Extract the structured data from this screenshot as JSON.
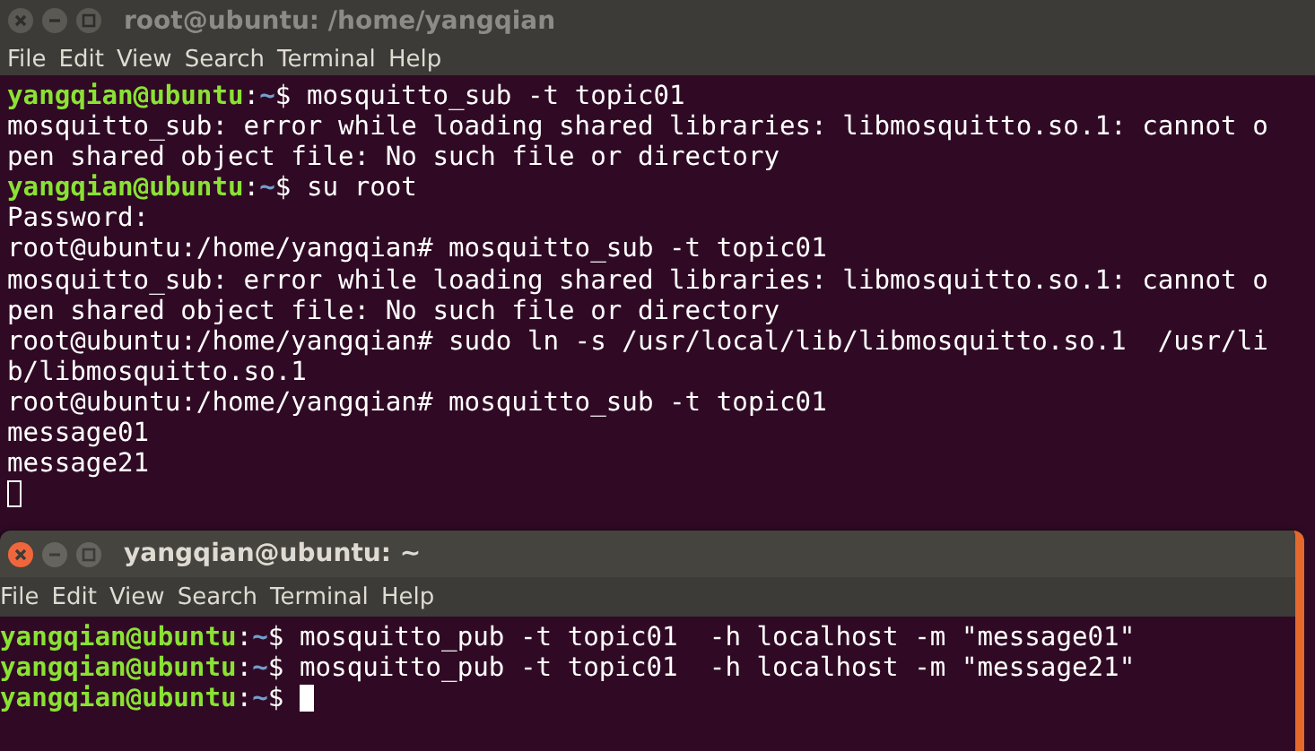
{
  "windows": [
    {
      "title": "root@ubuntu: /home/yangqian",
      "active": false,
      "menu": [
        "File",
        "Edit",
        "View",
        "Search",
        "Terminal",
        "Help"
      ],
      "lines": [
        {
          "kind": "prompt",
          "user": "yangqian@ubuntu",
          "sep": ":",
          "path": "~",
          "rest": "$ mosquitto_sub -t topic01"
        },
        {
          "kind": "output",
          "text": "mosquitto_sub: error while loading shared libraries: libmosquitto.so.1: cannot o"
        },
        {
          "kind": "output",
          "text": "pen shared object file: No such file or directory"
        },
        {
          "kind": "prompt",
          "user": "yangqian@ubuntu",
          "sep": ":",
          "path": "~",
          "rest": "$ su root"
        },
        {
          "kind": "output",
          "text": "Password:"
        },
        {
          "kind": "output",
          "text": "root@ubuntu:/home/yangqian# mosquitto_sub -t topic01"
        },
        {
          "kind": "output",
          "text": "mosquitto_sub: error while loading shared libraries: libmosquitto.so.1: cannot o"
        },
        {
          "kind": "output",
          "text": "pen shared object file: No such file or directory"
        },
        {
          "kind": "output",
          "text": "root@ubuntu:/home/yangqian# sudo ln -s /usr/local/lib/libmosquitto.so.1  /usr/li"
        },
        {
          "kind": "output",
          "text": "b/libmosquitto.so.1"
        },
        {
          "kind": "output",
          "text": "root@ubuntu:/home/yangqian# mosquitto_sub -t topic01"
        },
        {
          "kind": "output",
          "text": "message01"
        },
        {
          "kind": "output",
          "text": "message21"
        },
        {
          "kind": "cursor"
        }
      ]
    },
    {
      "title": "yangqian@ubuntu: ~",
      "active": true,
      "menu": [
        "File",
        "Edit",
        "View",
        "Search",
        "Terminal",
        "Help"
      ],
      "lines": [
        {
          "kind": "prompt",
          "user": "yangqian@ubuntu",
          "sep": ":",
          "path": "~",
          "rest": "$ mosquitto_pub -t topic01  -h localhost -m \"message01\""
        },
        {
          "kind": "prompt",
          "user": "yangqian@ubuntu",
          "sep": ":",
          "path": "~",
          "rest": "$ mosquitto_pub -t topic01  -h localhost -m \"message21\""
        },
        {
          "kind": "prompt_cursor",
          "user": "yangqian@ubuntu",
          "sep": ":",
          "path": "~",
          "rest": "$"
        }
      ]
    }
  ]
}
